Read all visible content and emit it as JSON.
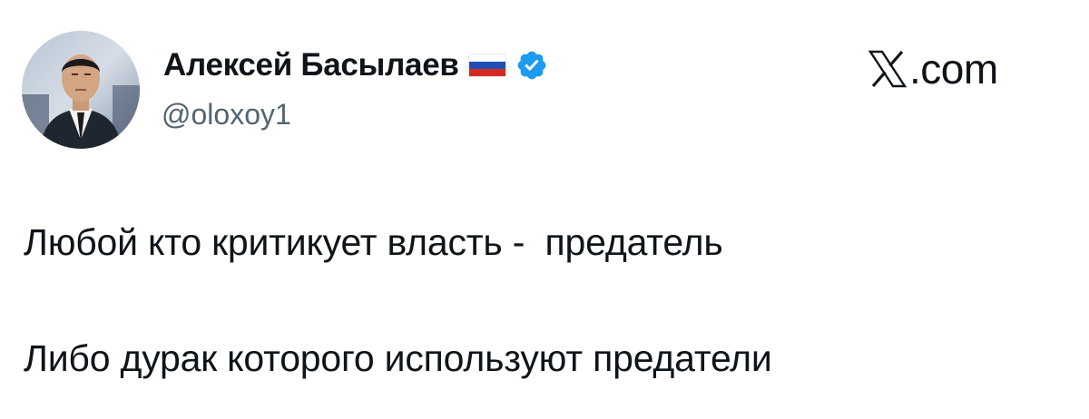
{
  "author": {
    "display_name": "Алексей Басылаев",
    "handle": "@oloxoy1",
    "flag_icon": "russia-flag-icon",
    "verified_icon": "verified-badge-icon",
    "verified_color": "#1d9bf0",
    "avatar_icon": "profile-photo"
  },
  "brand": {
    "logo_icon": "x-logo-icon",
    "suffix": ".com"
  },
  "tweet": {
    "lines": [
      "Любой кто критикует власть -  предатель",
      "Либо дурак которого используют предатели"
    ]
  },
  "colors": {
    "text": "#0f1419",
    "secondary_text": "#536471",
    "background": "#ffffff"
  }
}
